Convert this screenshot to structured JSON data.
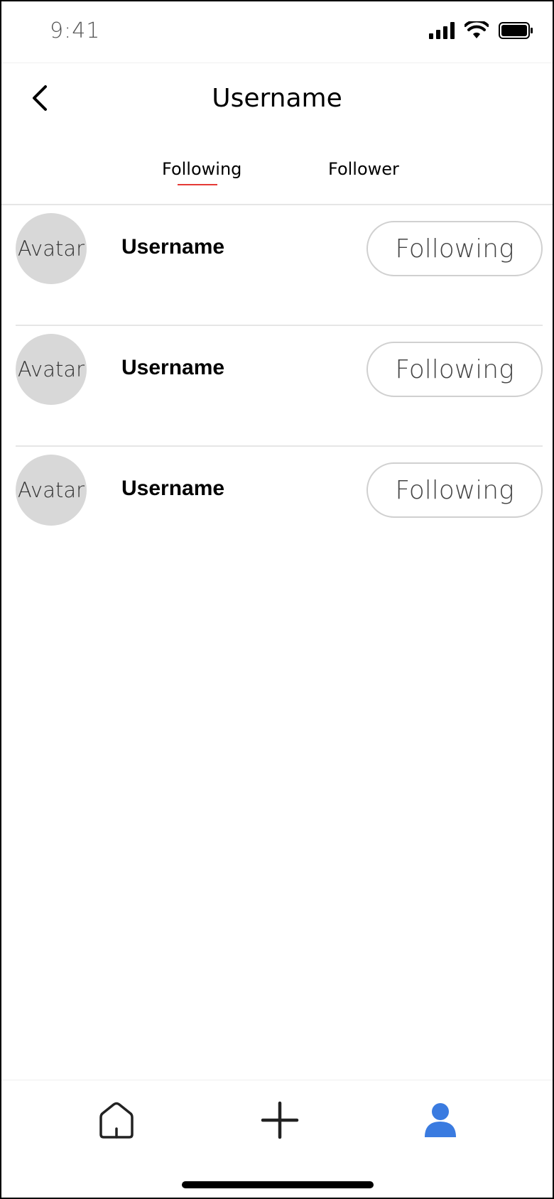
{
  "status": {
    "time": "9:41"
  },
  "header": {
    "title": "Username"
  },
  "tabs": [
    {
      "label": "Following",
      "active": true
    },
    {
      "label": "Follower",
      "active": false
    }
  ],
  "users": [
    {
      "avatar": "Avatar",
      "name": "Username",
      "button": "Following"
    },
    {
      "avatar": "Avatar",
      "name": "Username",
      "button": "Following"
    },
    {
      "avatar": "Avatar",
      "name": "Username",
      "button": "Following"
    }
  ],
  "bottom_nav": {
    "items": [
      {
        "icon": "home-icon"
      },
      {
        "icon": "plus-icon"
      },
      {
        "icon": "profile-icon",
        "active": true
      }
    ]
  },
  "colors": {
    "accent": "#e53935",
    "active_nav": "#3a7be0",
    "avatar_bg": "#d8d8d8"
  }
}
